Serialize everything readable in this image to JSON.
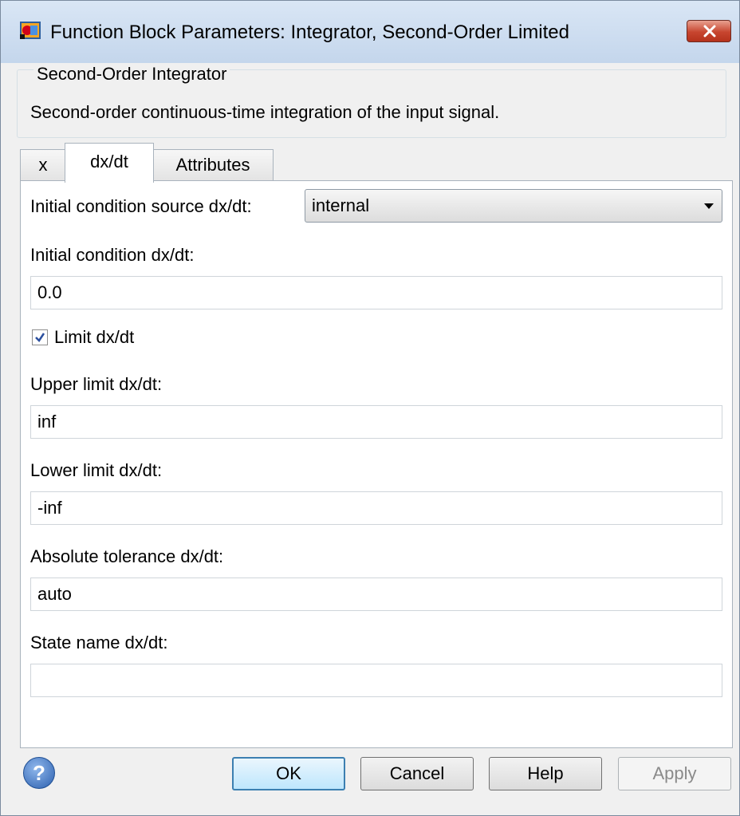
{
  "window": {
    "title": "Function Block Parameters: Integrator, Second-Order Limited",
    "close_icon": "close-icon",
    "app_icon": "simulink-block-icon"
  },
  "group": {
    "legend": "Second-Order Integrator",
    "description": "Second-order continuous-time integration of the input signal."
  },
  "tabs": [
    {
      "label": "x",
      "active": false
    },
    {
      "label": "dx/dt",
      "active": true
    },
    {
      "label": "Attributes",
      "active": false
    }
  ],
  "form": {
    "ic_source_label": "Initial condition source dx/dt:",
    "ic_source_value": "internal",
    "ic_label": "Initial condition dx/dt:",
    "ic_value": "0.0",
    "limit_label": "Limit dx/dt",
    "limit_checked": true,
    "upper_label": "Upper limit dx/dt:",
    "upper_value": "inf",
    "lower_label": "Lower limit dx/dt:",
    "lower_value": "-inf",
    "abstol_label": "Absolute tolerance dx/dt:",
    "abstol_value": "auto",
    "statename_label": "State name dx/dt:",
    "statename_value": ""
  },
  "buttons": {
    "help_icon_glyph": "?",
    "ok": "OK",
    "cancel": "Cancel",
    "help": "Help",
    "apply": "Apply"
  },
  "colors": {
    "titlebar": "#c4d6ec",
    "close_button": "#c7452f",
    "default_button_border": "#3c7fb1"
  }
}
